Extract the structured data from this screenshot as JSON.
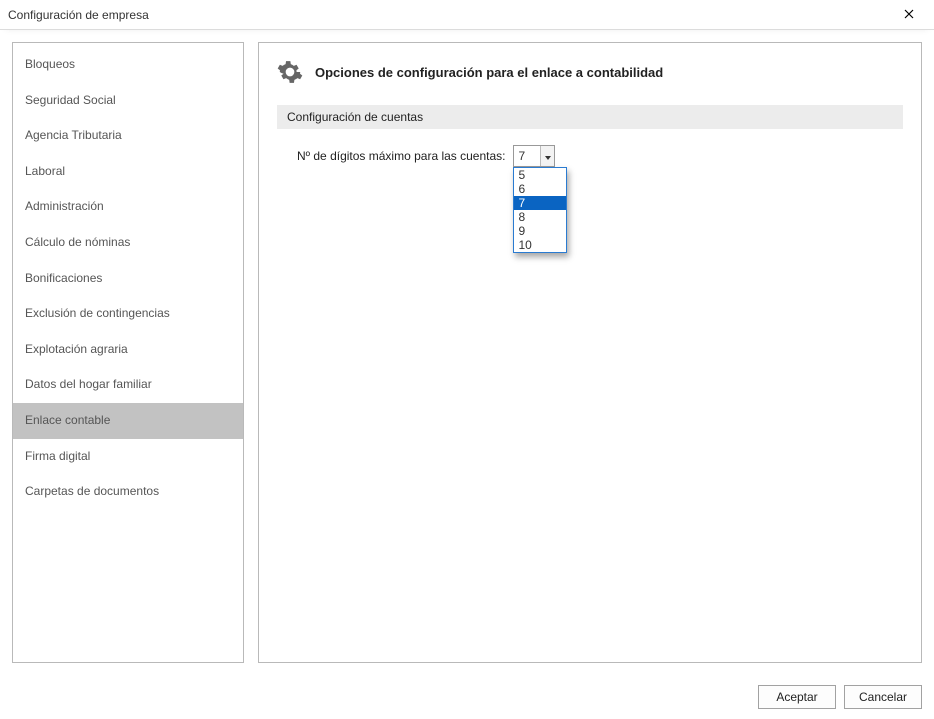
{
  "window": {
    "title": "Configuración de empresa"
  },
  "sidebar": {
    "items": [
      {
        "label": "Bloqueos",
        "selected": false,
        "name": "sidebar-item-bloqueos"
      },
      {
        "label": "Seguridad Social",
        "selected": false,
        "name": "sidebar-item-seguridad-social"
      },
      {
        "label": "Agencia Tributaria",
        "selected": false,
        "name": "sidebar-item-agencia-tributaria"
      },
      {
        "label": "Laboral",
        "selected": false,
        "name": "sidebar-item-laboral"
      },
      {
        "label": "Administración",
        "selected": false,
        "name": "sidebar-item-administracion"
      },
      {
        "label": "Cálculo de nóminas",
        "selected": false,
        "name": "sidebar-item-calculo-nominas"
      },
      {
        "label": "Bonificaciones",
        "selected": false,
        "name": "sidebar-item-bonificaciones"
      },
      {
        "label": "Exclusión de contingencias",
        "selected": false,
        "name": "sidebar-item-exclusion-contingencias"
      },
      {
        "label": "Explotación agraria",
        "selected": false,
        "name": "sidebar-item-explotacion-agraria"
      },
      {
        "label": "Datos del hogar familiar",
        "selected": false,
        "name": "sidebar-item-datos-hogar"
      },
      {
        "label": "Enlace contable",
        "selected": true,
        "name": "sidebar-item-enlace-contable"
      },
      {
        "label": "Firma digital",
        "selected": false,
        "name": "sidebar-item-firma-digital"
      },
      {
        "label": "Carpetas de documentos",
        "selected": false,
        "name": "sidebar-item-carpetas-documentos"
      }
    ]
  },
  "main": {
    "page_title": "Opciones de configuración para el enlace a contabilidad",
    "section_title": "Configuración de cuentas",
    "field_label": "Nº de dígitos máximo para las cuentas:",
    "digits_value": "7",
    "dropdown": {
      "open": true,
      "options": [
        {
          "label": "5",
          "highlight": false
        },
        {
          "label": "6",
          "highlight": false
        },
        {
          "label": "7",
          "highlight": true
        },
        {
          "label": "8",
          "highlight": false
        },
        {
          "label": "9",
          "highlight": false
        },
        {
          "label": "10",
          "highlight": false
        }
      ]
    }
  },
  "footer": {
    "accept_label": "Aceptar",
    "cancel_label": "Cancelar"
  }
}
